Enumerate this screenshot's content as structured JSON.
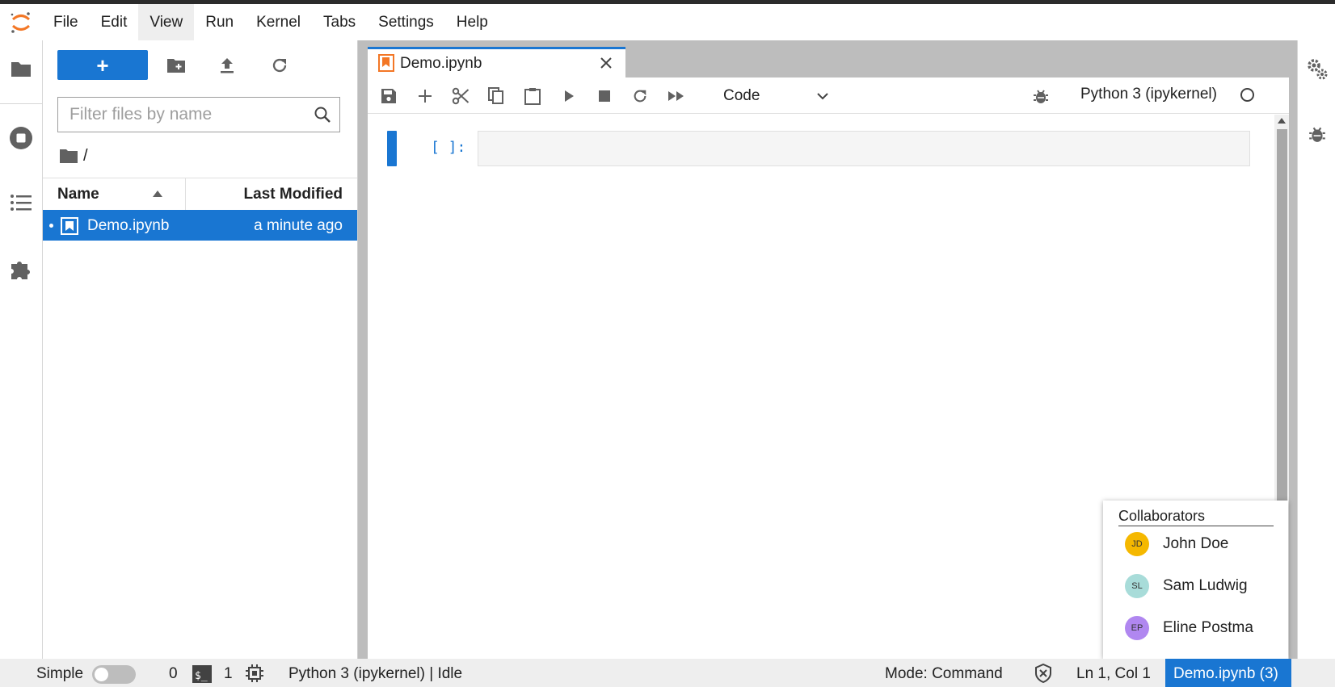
{
  "menu": {
    "items": [
      "File",
      "Edit",
      "View",
      "Run",
      "Kernel",
      "Tabs",
      "Settings",
      "Help"
    ],
    "active_index": 2
  },
  "file_browser": {
    "new_button_label": "+",
    "filter_placeholder": "Filter files by name",
    "breadcrumb": "/",
    "columns": {
      "name": "Name",
      "modified": "Last Modified"
    },
    "files": [
      {
        "name": "Demo.ipynb",
        "modified": "a minute ago",
        "selected": true
      }
    ]
  },
  "notebook": {
    "tab_title": "Demo.ipynb",
    "cell_type": "Code",
    "kernel": "Python 3 (ipykernel)",
    "cell_prompt": "[ ]:"
  },
  "collaborators": {
    "title": "Collaborators",
    "people": [
      {
        "initials": "JD",
        "name": "John Doe",
        "color": "#f5b800"
      },
      {
        "initials": "SL",
        "name": "Sam Ludwig",
        "color": "#a8dcd9"
      },
      {
        "initials": "EP",
        "name": "Eline Postma",
        "color": "#b087f0"
      }
    ]
  },
  "status_bar": {
    "simple_label": "Simple",
    "terminals_count": "0",
    "kernels_count": "1",
    "kernel_status": "Python 3 (ipykernel) | Idle",
    "mode": "Mode: Command",
    "cursor": "Ln 1, Col 1",
    "active_doc": "Demo.ipynb (3)"
  },
  "colors": {
    "accent": "#1976d2",
    "logo": "#f37726"
  }
}
